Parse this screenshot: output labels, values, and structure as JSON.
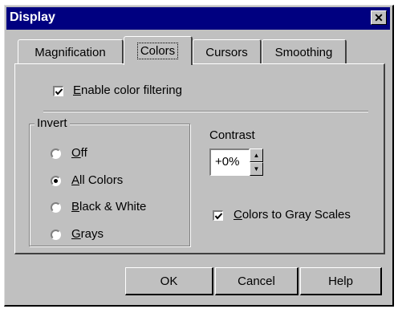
{
  "window": {
    "title": "Display"
  },
  "tabs": [
    "Magnification",
    "Colors",
    "Cursors",
    "Smoothing"
  ],
  "filter": {
    "pre": "",
    "accel": "E",
    "post": "nable color filtering",
    "checked": true
  },
  "invert": {
    "label": "Invert",
    "options": [
      {
        "pre": "",
        "accel": "O",
        "post": "ff",
        "selected": false
      },
      {
        "pre": "",
        "accel": "A",
        "post": "ll Colors",
        "selected": true
      },
      {
        "pre": "",
        "accel": "B",
        "post": "lack & White",
        "selected": false
      },
      {
        "pre": "",
        "accel": "G",
        "post": "rays",
        "selected": false
      }
    ]
  },
  "contrast": {
    "label": "Contrast",
    "value": "+0%"
  },
  "gray": {
    "pre": "",
    "accel": "C",
    "post": "olors to Gray Scales",
    "checked": true
  },
  "buttons": {
    "ok": "OK",
    "cancel": "Cancel",
    "help": "Help"
  },
  "icons": {
    "close": "close-icon",
    "check": "checkmark-icon",
    "up": "spin-up-arrow-icon",
    "down": "spin-down-arrow-icon"
  }
}
